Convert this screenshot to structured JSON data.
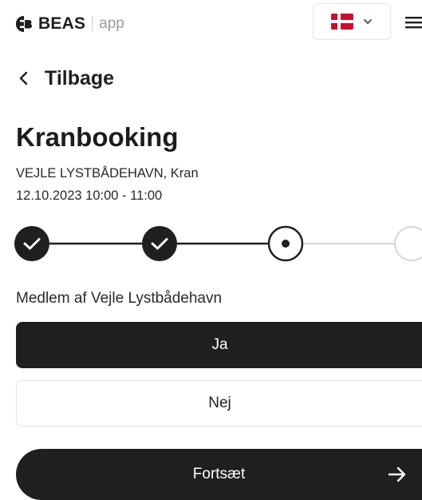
{
  "header": {
    "brand": "BEAS",
    "brand_suffix": "app",
    "language_flag": "denmark-flag",
    "menu_icon": "hamburger-menu-icon"
  },
  "nav": {
    "back_label": "Tilbage"
  },
  "booking": {
    "title": "Kranbooking",
    "location": "VEJLE LYSTBÅDEHAVN, Kran",
    "datetime": "12.10.2023 10:00 - 11:00"
  },
  "stepper": {
    "total_steps": 4,
    "current_step": 3,
    "steps": [
      {
        "state": "completed"
      },
      {
        "state": "completed"
      },
      {
        "state": "current"
      },
      {
        "state": "upcoming"
      }
    ]
  },
  "form": {
    "question": "Medlem af Vejle Lystbådehavn",
    "options": [
      {
        "label": "Ja",
        "selected": true
      },
      {
        "label": "Nej",
        "selected": false
      }
    ],
    "continue_label": "Fortsæt"
  },
  "colors": {
    "primary": "#1f1f1f",
    "flag_red": "#c8102e",
    "muted_line": "#d6d6d6"
  }
}
